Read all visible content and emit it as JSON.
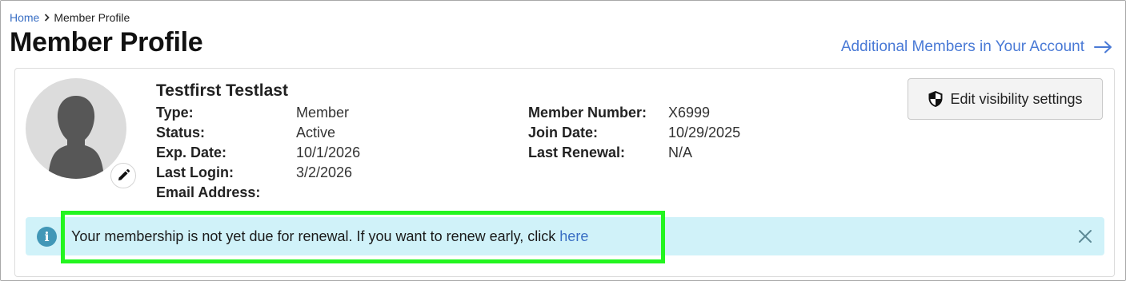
{
  "breadcrumb": {
    "home": "Home",
    "current": "Member Profile"
  },
  "page": {
    "title": "Member Profile"
  },
  "additional_members_link": "Additional Members in Your Account",
  "profile": {
    "name": "Testfirst Testlast",
    "left_fields": [
      {
        "label": "Type:",
        "value": "Member"
      },
      {
        "label": "Status:",
        "value": "Active"
      },
      {
        "label": "Exp. Date:",
        "value": "10/1/2026"
      },
      {
        "label": "Last Login:",
        "value": "3/2/2026"
      },
      {
        "label": "Email Address:",
        "value": ""
      }
    ],
    "right_fields": [
      {
        "label": "Member Number:",
        "value": "X6999"
      },
      {
        "label": "Join Date:",
        "value": "10/29/2025"
      },
      {
        "label": "Last Renewal:",
        "value": "N/A"
      }
    ]
  },
  "visibility_button": "Edit visibility settings",
  "alert": {
    "icon": "info-icon",
    "message": "Your membership is not yet due for renewal. If you want to renew early, click",
    "link_text": "here"
  },
  "colors": {
    "link": "#3a6fc4",
    "alert_bg": "#d0f2f9",
    "alert_icon": "#4197b7",
    "highlight": "#23f51f"
  }
}
